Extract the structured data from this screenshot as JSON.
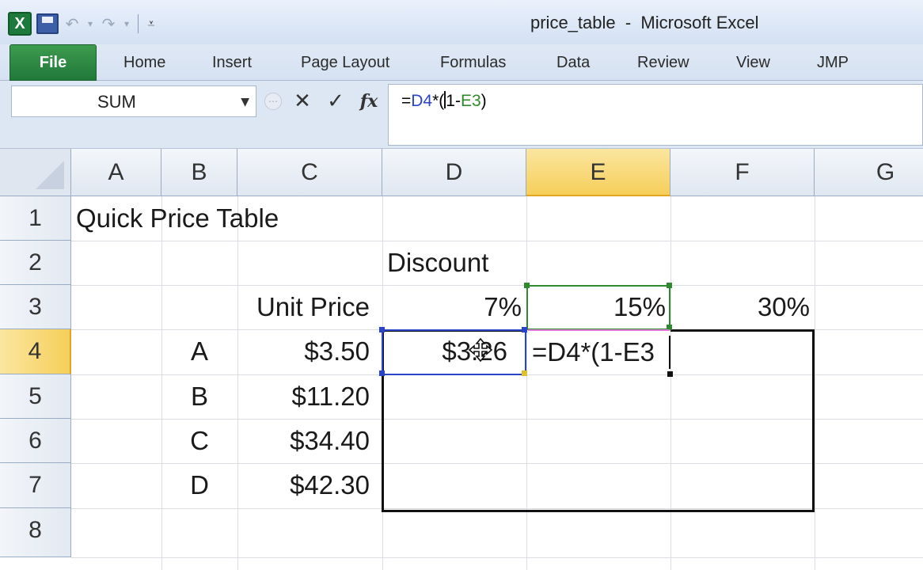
{
  "window": {
    "title": "price_table  -  Microsoft Excel"
  },
  "qat": {
    "app_icon": "X",
    "undo_glyph": "↶",
    "redo_glyph": "↷",
    "dropdown_glyph": "▾",
    "customize_glyph": "⩡"
  },
  "ribbon": {
    "file_tab": "File",
    "tabs": [
      "Home",
      "Insert",
      "Page Layout",
      "Formulas",
      "Data",
      "Review",
      "View",
      "JMP"
    ]
  },
  "formula_bar": {
    "name_box": "SUM",
    "name_box_arrow": "▼",
    "cancel_glyph": "✕",
    "enter_glyph": "✓",
    "fx_glyph": "fx",
    "formula_prefix": "=",
    "formula_ref1": "D4",
    "formula_mid": "*(",
    "formula_mid2": "1-",
    "formula_ref2": "E3",
    "formula_suffix": ")"
  },
  "sheet": {
    "columns": [
      "A",
      "B",
      "C",
      "D",
      "E",
      "F",
      "G"
    ],
    "rows": [
      "1",
      "2",
      "3",
      "4",
      "5",
      "6",
      "7",
      "8"
    ],
    "active_column": "E",
    "active_row": "4",
    "cells": {
      "A1": "Quick Price Table",
      "D2": "Discount",
      "C3": "Unit Price",
      "D3": "7%",
      "E3": "15%",
      "F3": "30%",
      "B4": "A",
      "C4": "$3.50",
      "D4": "$3.26",
      "B5": "B",
      "C5": "$11.20",
      "B6": "C",
      "C6": "$34.40",
      "B7": "D",
      "C7": "$42.30"
    },
    "editing_cell": {
      "address": "E4",
      "prefix": "=",
      "ref1": "D4",
      "mid": "*(1-",
      "ref2": "E3"
    }
  },
  "colors": {
    "reference_d4": "#2a44c9",
    "reference_e3": "#2f8a2f",
    "file_tab": "#21793a",
    "active_header": "#f6cf5a"
  },
  "icons": {
    "app": "excel-logo-icon",
    "save": "save-icon",
    "cursor": "move-cursor-icon"
  }
}
